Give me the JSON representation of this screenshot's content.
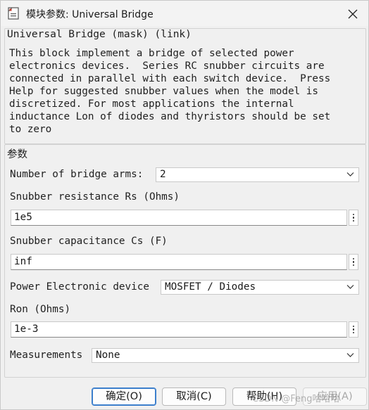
{
  "window": {
    "title": "模块参数: Universal Bridge",
    "close_icon": "close-icon",
    "app_icon": "dialog-icon"
  },
  "mask": {
    "heading": "Universal Bridge (mask) (link)",
    "description": "This block implement a bridge of selected power\nelectronics devices.  Series RC snubber circuits are\nconnected in parallel with each switch device.  Press\nHelp for suggested snubber values when the model is\ndiscretized. For most applications the internal\ninductance Lon of diodes and thyristors should be set\nto zero"
  },
  "params": {
    "heading": "参数",
    "bridge_arms": {
      "label": "Number of bridge arms:",
      "value": "2"
    },
    "rs": {
      "label": "Snubber resistance Rs (Ohms)",
      "value": "1e5"
    },
    "cs": {
      "label": "Snubber capacitance Cs (F)",
      "value": "inf"
    },
    "device": {
      "label": "Power Electronic device",
      "value": "MOSFET / Diodes"
    },
    "ron": {
      "label": "Ron (Ohms)",
      "value": "1e-3"
    },
    "measurements": {
      "label": "Measurements",
      "value": "None"
    }
  },
  "buttons": {
    "ok": "确定(O)",
    "cancel": "取消(C)",
    "help": "帮助(H)",
    "apply": "应用(A)"
  },
  "watermark": "CSDN @Feng哈哈哈",
  "colors": {
    "accent": "#3c7fcc",
    "window_bg": "#f0f0f0",
    "disabled_text": "#a9a9a9"
  }
}
